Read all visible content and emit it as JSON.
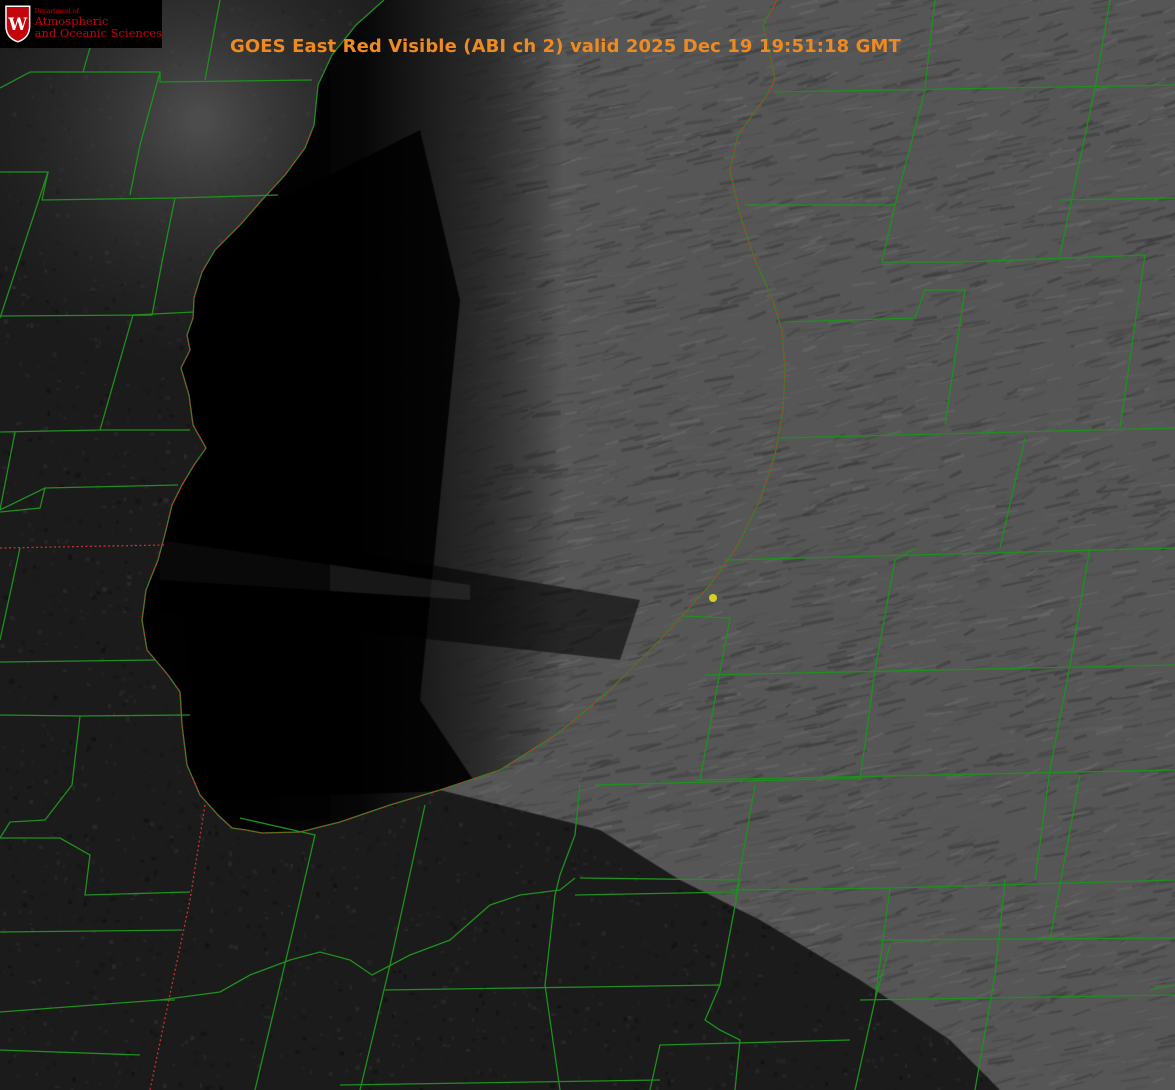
{
  "title": "GOES East Red Visible (ABI ch 2) valid 2025 Dec 19 19:51:18 GMT",
  "logo": {
    "dept_line": "Department of",
    "line1": "Atmospheric",
    "line2": "and Oceanic Sciences",
    "seal_letter": "W"
  },
  "colors": {
    "title": "#ee8a22",
    "logo": "#c5050c",
    "county_lines": "#1f8f1f",
    "state_border": "#c43232",
    "station_marker": "#d8d020",
    "lake_water": "#030303"
  },
  "map": {
    "imagery": "satellite-visible-grayscale",
    "feature": "lake-effect cloud bands over southern Lake Michigan shore",
    "station_marker_color": "yellow"
  }
}
